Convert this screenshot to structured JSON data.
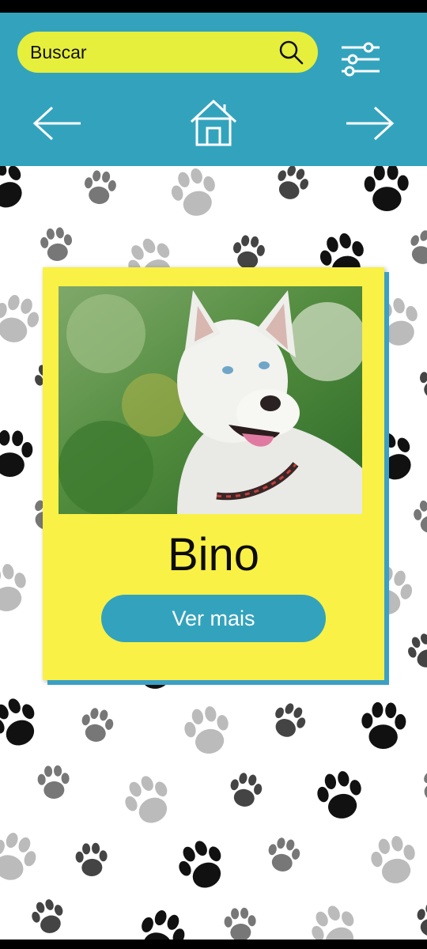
{
  "search": {
    "label": "Buscar",
    "icon": "search-icon"
  },
  "header": {
    "background": "#33a3bd",
    "search_background": "#e6ef3b"
  },
  "nav": {
    "back_icon": "arrow-left-icon",
    "home_icon": "home-icon",
    "forward_icon": "arrow-right-icon",
    "filter_icon": "sliders-icon"
  },
  "card": {
    "name": "Bino",
    "button_label": "Ver mais",
    "background": "#f9f145",
    "button_color": "#33a3bd"
  }
}
